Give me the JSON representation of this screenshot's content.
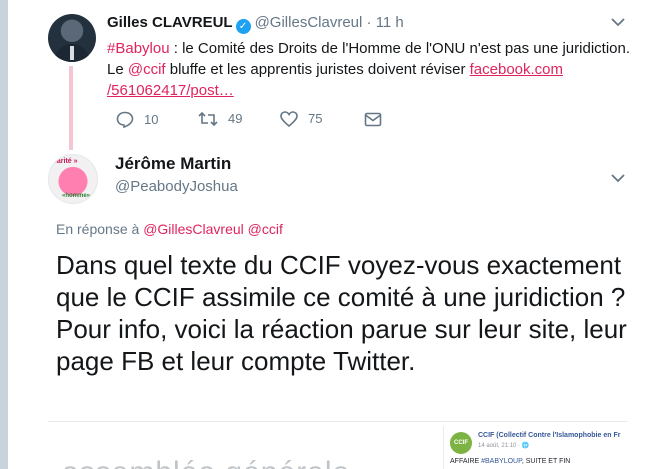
{
  "tweet1": {
    "author_name": "Gilles CLAVREUL",
    "verified_icon": "✓",
    "handle": "@GillesClavreul",
    "separator": "·",
    "time": "11 h",
    "text": {
      "hashtag": "#Babylou",
      "part1": " : le Comité des Droits de l'Homme de l'ONU n'est pas une juridiction. Le ",
      "mention": "@ccif",
      "part2": " bluffe et les apprentis juristes doivent réviser ",
      "link": "facebook.com\n/561062417/post…"
    },
    "actions": {
      "reply_count": "10",
      "retweet_count": "49",
      "like_count": "75"
    }
  },
  "tweet2": {
    "author_name": "Jérôme Martin",
    "handle": "@PeabodyJoshua",
    "avatar_top_text": "«arité »",
    "avatar_bottom_text": "«homme»",
    "reply_label": "En réponse à",
    "reply_mentions": "@GillesClavreul @ccif",
    "text": "Dans quel texte du CCIF voyez-vous exactement que le CCIF assimile ce comité à une juridiction ? Pour info, voici la réaction parue sur leur site, leur page FB et leur compte Twitter."
  },
  "embed": {
    "ghost_text": "assemblée générale",
    "fb_logo_text": "CCIF",
    "fb_page_name": "CCIF (Collectif Contre l'Islamophobie en Fr",
    "fb_date": "14 août, 21:10 · 🌐",
    "fb_post_prefix": "AFFAIRE ",
    "fb_post_tag": "#BABYLOUP",
    "fb_post_suffix": ", SUITE ET FIN"
  },
  "colors": {
    "link": "#e0245e",
    "muted": "#657786",
    "verified": "#1da1f2",
    "thread_line": "#f5c5d2"
  },
  "icons": [
    "verified-icon",
    "chevron-down-icon",
    "reply-icon",
    "retweet-icon",
    "like-icon",
    "dm-icon"
  ]
}
